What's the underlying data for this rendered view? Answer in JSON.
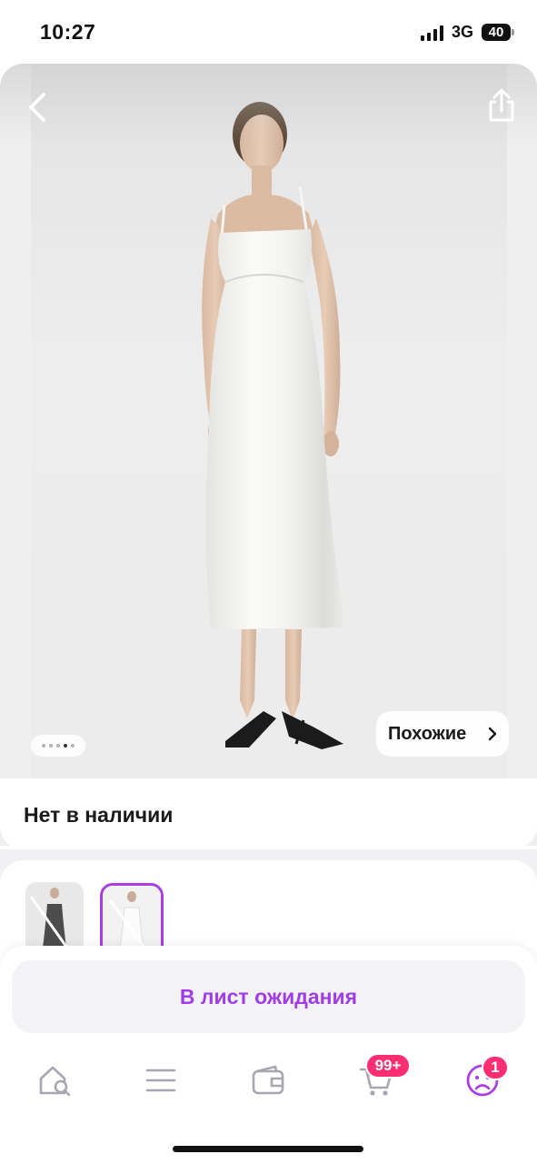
{
  "status_bar": {
    "time": "10:27",
    "network": "3G",
    "battery": "40"
  },
  "product": {
    "back_icon": "chevron-left-icon",
    "share_icon": "share-icon",
    "gallery": {
      "page_count": 5,
      "active_page": 4
    },
    "similar_label": "Похожие",
    "availability": "Нет в наличии"
  },
  "variants": [
    {
      "icon": "variant-thumbnail-dark",
      "selected": false
    },
    {
      "icon": "variant-thumbnail-white",
      "selected": true
    }
  ],
  "action": {
    "waitlist_label": "В лист ожидания"
  },
  "tabbar": {
    "items": [
      {
        "icon": "home-search-icon"
      },
      {
        "icon": "catalog-menu-icon"
      },
      {
        "icon": "wallet-icon"
      },
      {
        "icon": "cart-icon",
        "badge": "99+"
      },
      {
        "icon": "profile-icon",
        "badge": "1"
      }
    ]
  },
  "colors": {
    "accent": "#a13de8",
    "badge": "#ff2e73"
  }
}
